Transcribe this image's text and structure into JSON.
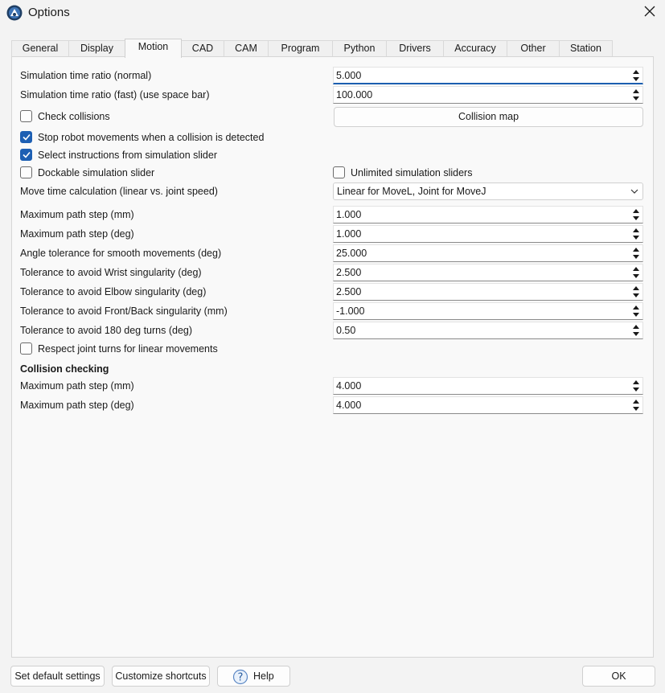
{
  "window": {
    "title": "Options"
  },
  "tabs": [
    {
      "label": "General",
      "active": false
    },
    {
      "label": "Display",
      "active": false
    },
    {
      "label": "Motion",
      "active": true
    },
    {
      "label": "CAD",
      "active": false
    },
    {
      "label": "CAM",
      "active": false
    },
    {
      "label": "Program",
      "active": false
    },
    {
      "label": "Python",
      "active": false
    },
    {
      "label": "Drivers",
      "active": false
    },
    {
      "label": "Accuracy",
      "active": false
    },
    {
      "label": "Other",
      "active": false
    },
    {
      "label": "Station",
      "active": false
    }
  ],
  "motion": {
    "sim_ratio_normal": {
      "label": "Simulation time ratio (normal)",
      "value": "5.000"
    },
    "sim_ratio_fast": {
      "label": "Simulation time ratio (fast) (use space bar)",
      "value": "100.000"
    },
    "check_collisions": {
      "label": "Check collisions",
      "checked": false
    },
    "collision_map_button": "Collision map",
    "stop_on_collision": {
      "label": "Stop robot movements when a collision is detected",
      "checked": true
    },
    "select_from_slider": {
      "label": "Select instructions from simulation slider",
      "checked": true
    },
    "dockable_slider": {
      "label": "Dockable simulation slider",
      "checked": false
    },
    "unlimited_sliders": {
      "label": "Unlimited simulation sliders",
      "checked": false
    },
    "move_time_calc": {
      "label": "Move time calculation (linear vs. joint speed)",
      "value": "Linear for MoveL, Joint for MoveJ"
    },
    "max_path_step_mm": {
      "label": "Maximum path step (mm)",
      "value": "1.000"
    },
    "max_path_step_deg": {
      "label": "Maximum path step (deg)",
      "value": "1.000"
    },
    "angle_tolerance": {
      "label": "Angle tolerance for smooth movements (deg)",
      "value": "25.000"
    },
    "wrist_tolerance": {
      "label": "Tolerance to avoid Wrist singularity (deg)",
      "value": "2.500"
    },
    "elbow_tolerance": {
      "label": "Tolerance to avoid Elbow singularity (deg)",
      "value": "2.500"
    },
    "frontback_tolerance": {
      "label": "Tolerance to avoid Front/Back singularity (mm)",
      "value": "-1.000"
    },
    "turn180_tolerance": {
      "label": "Tolerance to avoid 180 deg turns (deg)",
      "value": "0.50"
    },
    "respect_joint_turns": {
      "label": "Respect joint turns for linear movements",
      "checked": false
    }
  },
  "collision_checking": {
    "heading": "Collision checking",
    "max_path_step_mm": {
      "label": "Maximum path step (mm)",
      "value": "4.000"
    },
    "max_path_step_deg": {
      "label": "Maximum path step (deg)",
      "value": "4.000"
    }
  },
  "footer": {
    "default_settings": "Set default settings",
    "customize_shortcuts": "Customize shortcuts",
    "help": "Help",
    "ok": "OK"
  },
  "colors": {
    "accent": "#1d5fb3",
    "background": "#f3f3f3",
    "panel": "#f9f9f9"
  },
  "icons": {
    "app": "robodk-logo-icon",
    "close": "close-icon",
    "help": "help-circle-icon"
  }
}
